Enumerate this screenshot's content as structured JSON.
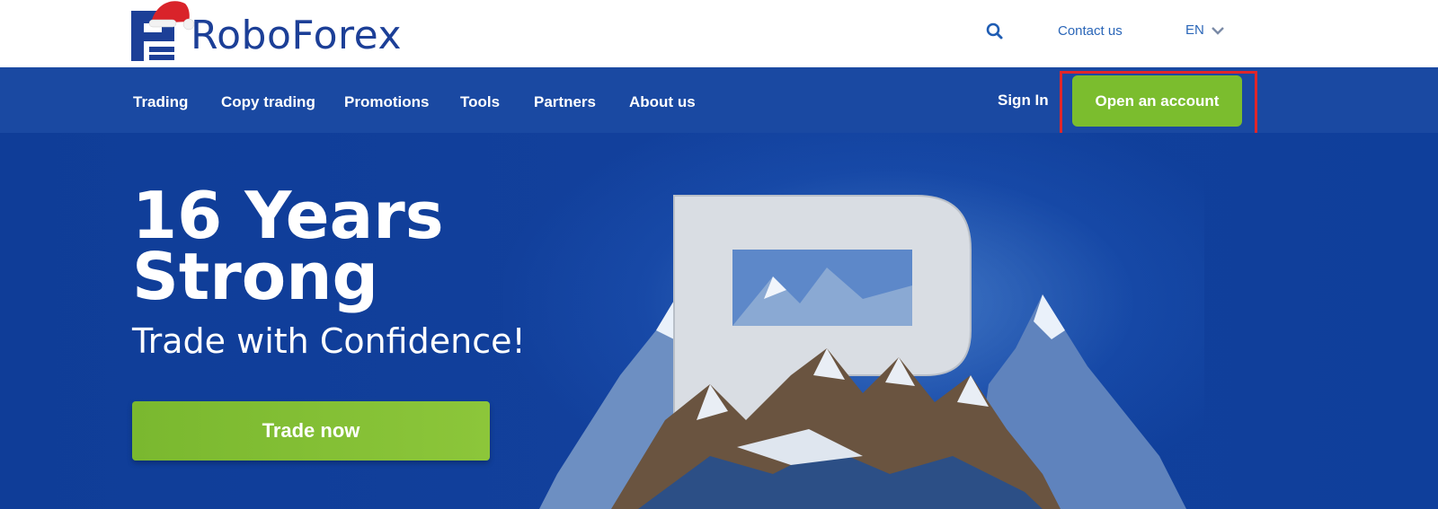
{
  "header": {
    "logo_text": "RoboForex",
    "contact_label": "Contact us",
    "language": "EN"
  },
  "nav": {
    "items": [
      {
        "label": "Trading"
      },
      {
        "label": "Copy trading"
      },
      {
        "label": "Promotions"
      },
      {
        "label": "Tools"
      },
      {
        "label": "Partners"
      },
      {
        "label": "About us"
      }
    ],
    "signin_label": "Sign In",
    "open_account_label": "Open an account"
  },
  "hero": {
    "title_line1": "16 Years",
    "title_line2": "Strong",
    "subtitle": "Trade with Confidence!",
    "cta_label": "Trade now"
  },
  "colors": {
    "brand_blue": "#1c3f97",
    "nav_blue": "#1a49a2",
    "hero_blue": "#0f3d98",
    "accent_green": "#7bbd2e",
    "highlight_red": "#e0262a"
  },
  "icons": {
    "search": "search-icon",
    "language_toggle": "chevron-down-icon",
    "logo_mark": "roboforex-logo-icon",
    "hat": "santa-hat-icon"
  }
}
